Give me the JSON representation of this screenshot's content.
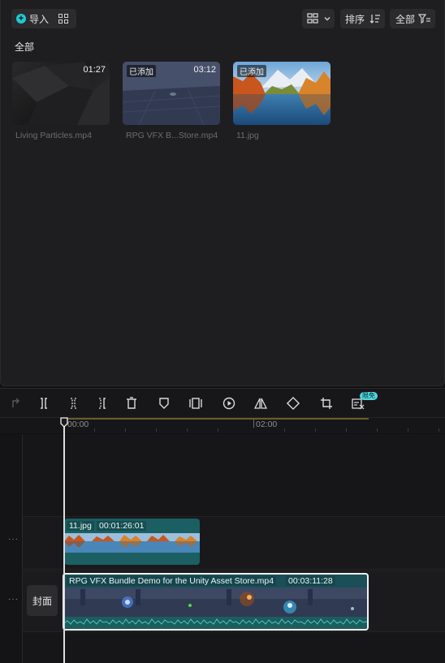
{
  "media": {
    "import_label": "导入",
    "sort_label": "排序",
    "filter_label": "全部",
    "section_label": "全部",
    "items": [
      {
        "name": "Living Particles.mp4",
        "duration": "01:27",
        "badge": ""
      },
      {
        "name": "RPG VFX B...Store.mp4",
        "duration": "03:12",
        "badge": "已添加"
      },
      {
        "name": "11.jpg",
        "duration": "",
        "badge": "已添加"
      }
    ]
  },
  "timeline": {
    "toolbar_icons": [
      "undo-icon",
      "split-icon",
      "trim-left-icon",
      "trim-right-icon",
      "delete-icon",
      "marker-icon",
      "freeze-frame-icon",
      "reverse-icon",
      "mirror-icon",
      "rotate-icon",
      "crop-icon",
      "auto-caption-icon"
    ],
    "limit_badge": "限免",
    "ruler_labels": [
      "00:00",
      "02:00"
    ],
    "image_clip": {
      "name": "11.jpg",
      "duration": "00:01:26:01"
    },
    "video_clip": {
      "name": "RPG VFX Bundle   Demo for the Unity Asset Store.mp4",
      "duration": "00:03:11:28"
    },
    "cover_label": "封面",
    "track_menu_glyph": "···"
  },
  "colors": {
    "accent": "#20c9d0",
    "clip_teal": "#1b5f62",
    "selection": "#f4f4f4"
  }
}
